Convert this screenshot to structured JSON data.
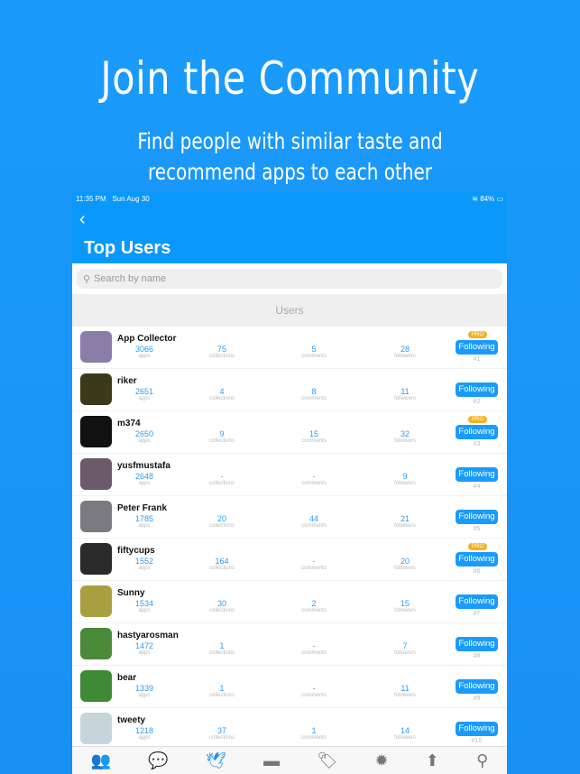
{
  "promo": {
    "headline": "Join the Community",
    "sub1": "Find people with similar taste and",
    "sub2": "recommend apps to each other"
  },
  "status": {
    "time": "11:35 PM",
    "date": "Sun Aug 30",
    "battery": "84%"
  },
  "header": {
    "title": "Top Users"
  },
  "search": {
    "placeholder": "Search by name"
  },
  "section": "Users",
  "labels": {
    "apps": "apps",
    "collections": "collections",
    "comments": "comments",
    "followers": "followers",
    "following": "Following",
    "pro": "PRO"
  },
  "users": [
    {
      "name": "App Collector",
      "apps": "3066",
      "collections": "75",
      "comments": "5",
      "followers": "28",
      "pro": true,
      "rank": "#1",
      "color": "#8a7ea8"
    },
    {
      "name": "riker",
      "apps": "2651",
      "collections": "4",
      "comments": "8",
      "followers": "11",
      "pro": false,
      "rank": "#2",
      "color": "#3a3a1a"
    },
    {
      "name": "m374",
      "apps": "2650",
      "collections": "9",
      "comments": "15",
      "followers": "32",
      "pro": true,
      "rank": "#3",
      "color": "#111"
    },
    {
      "name": "yusfmustafa",
      "apps": "2648",
      "collections": "-",
      "comments": "-",
      "followers": "9",
      "pro": false,
      "rank": "#4",
      "color": "#6a5a6a"
    },
    {
      "name": "Peter Frank",
      "apps": "1785",
      "collections": "20",
      "comments": "44",
      "followers": "21",
      "pro": false,
      "rank": "#5",
      "color": "#7a7a80"
    },
    {
      "name": "fiftycups",
      "apps": "1552",
      "collections": "164",
      "comments": "-",
      "followers": "20",
      "pro": true,
      "rank": "#6",
      "color": "#2a2a2a"
    },
    {
      "name": "Sunny",
      "apps": "1534",
      "collections": "30",
      "comments": "2",
      "followers": "15",
      "pro": false,
      "rank": "#7",
      "color": "#a8a040"
    },
    {
      "name": "hastyarosman",
      "apps": "1472",
      "collections": "1",
      "comments": "-",
      "followers": "7",
      "pro": false,
      "rank": "#8",
      "color": "#4a8a3a"
    },
    {
      "name": "bear",
      "apps": "1339",
      "collections": "1",
      "comments": "-",
      "followers": "11",
      "pro": false,
      "rank": "#9",
      "color": "#3f8a35"
    },
    {
      "name": "tweety",
      "apps": "1218",
      "collections": "37",
      "comments": "1",
      "followers": "14",
      "pro": false,
      "rank": "#10",
      "color": "#c8d4dc"
    }
  ],
  "tabs": [
    {
      "icon": "users-icon"
    },
    {
      "icon": "chat-icon"
    },
    {
      "icon": "bird-icon"
    },
    {
      "icon": "collections-icon"
    },
    {
      "icon": "sale-tag-icon"
    },
    {
      "icon": "new-badge-icon"
    },
    {
      "icon": "upload-arrow-icon"
    },
    {
      "icon": "search-icon"
    }
  ]
}
